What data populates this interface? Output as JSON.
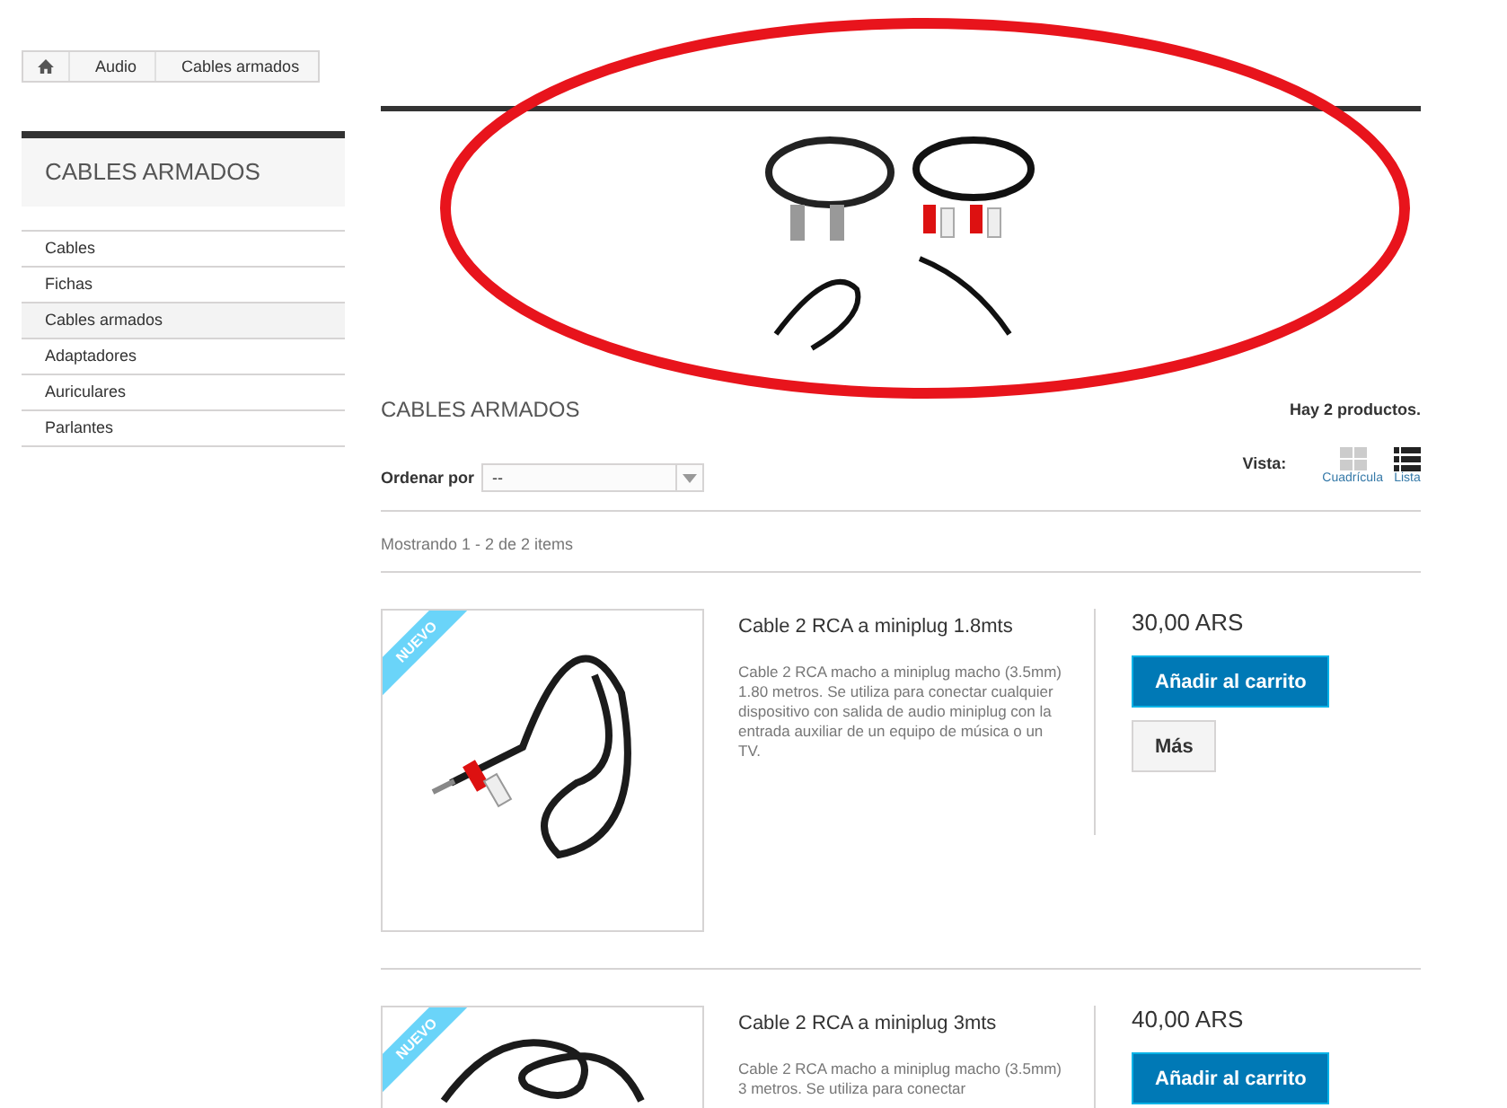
{
  "breadcrumb": [
    "Audio",
    "Cables armados"
  ],
  "sidebar": {
    "title": "CABLES ARMADOS",
    "items": [
      {
        "label": "Cables",
        "selected": false
      },
      {
        "label": "Fichas",
        "selected": false
      },
      {
        "label": "Cables armados",
        "selected": true
      },
      {
        "label": "Adaptadores",
        "selected": false
      },
      {
        "label": "Auriculares",
        "selected": false
      },
      {
        "label": "Parlantes",
        "selected": false
      }
    ]
  },
  "category": {
    "title": "CABLES ARMADOS",
    "count": "Hay 2 productos."
  },
  "sort": {
    "label": "Ordenar por",
    "value": "--"
  },
  "view": {
    "label": "Vista:",
    "options": [
      {
        "kind": "grid",
        "label": "Cuadrícula",
        "selected": false
      },
      {
        "kind": "list",
        "label": "Lista",
        "selected": true
      }
    ]
  },
  "showing": "Mostrando 1 - 2 de 2 items",
  "products": [
    {
      "badge": "NUEVO",
      "name": "Cable 2 RCA a miniplug 1.8mts",
      "description": "Cable 2 RCA macho a miniplug macho (3.5mm) 1.80 metros. Se utiliza para conectar cualquier dispositivo con salida de audio miniplug con la entrada auxiliar de un equipo de música o un TV.",
      "price": "30,00 ARS",
      "buttons": [
        "Añadir al carrito",
        "Más"
      ]
    },
    {
      "badge": "NUEVO",
      "name": "Cable 2 RCA a miniplug 3mts",
      "description": "Cable 2 RCA macho a miniplug macho (3.5mm) 3 metros. Se utiliza para conectar",
      "price": "40,00 ARS",
      "buttons": [
        "Añadir al carrito"
      ]
    }
  ]
}
